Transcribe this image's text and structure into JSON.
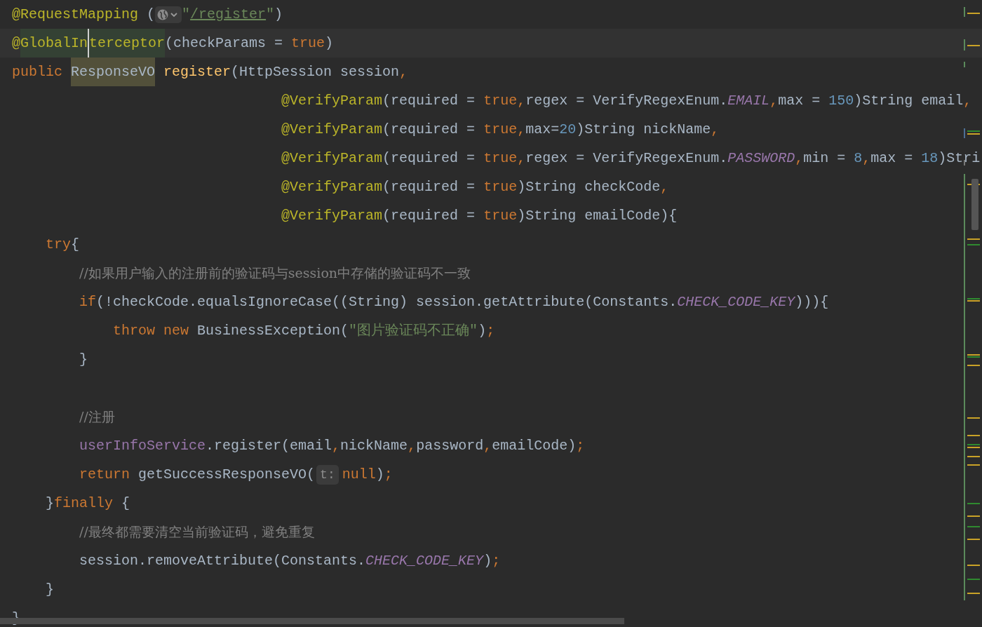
{
  "editor": {
    "lines": [
      {
        "kind": "code",
        "tokens": [
          {
            "text": "@RequestMapping",
            "kind": "annotation"
          },
          {
            "text": " (",
            "kind": "plain"
          },
          {
            "kind": "url-hint"
          },
          {
            "text": "\"",
            "kind": "string"
          },
          {
            "text": "/register",
            "kind": "link"
          },
          {
            "text": "\"",
            "kind": "string"
          },
          {
            "text": ")",
            "kind": "plain"
          }
        ]
      },
      {
        "kind": "code",
        "tokens": [
          {
            "text": "@",
            "kind": "annotation"
          },
          {
            "text": "GlobalIn",
            "kind": "annotation",
            "highlighted": true
          },
          {
            "text": "terceptor",
            "kind": "annotation",
            "highlighted": true,
            "caret_before": true
          },
          {
            "text": "(checkParams = ",
            "kind": "plain"
          },
          {
            "text": "true",
            "kind": "keyword"
          },
          {
            "text": ")",
            "kind": "plain"
          }
        ]
      },
      {
        "kind": "code",
        "tokens": [
          {
            "text": "public ",
            "kind": "keyword"
          },
          {
            "text": "ResponseVO",
            "kind": "plain",
            "highlighted": true
          },
          {
            "text": " register",
            "kind": "method"
          },
          {
            "text": "(HttpSession session",
            "kind": "plain"
          },
          {
            "text": ",",
            "kind": "keyword"
          }
        ]
      },
      {
        "kind": "code",
        "tokens": [
          {
            "text": "                                @VerifyParam",
            "kind": "annotation"
          },
          {
            "text": "(required = ",
            "kind": "plain"
          },
          {
            "text": "true,",
            "kind": "keyword"
          },
          {
            "text": "regex = VerifyRegexEnum.",
            "kind": "plain"
          },
          {
            "text": "EMAIL",
            "kind": "constant"
          },
          {
            "text": ",",
            "kind": "keyword"
          },
          {
            "text": "max = ",
            "kind": "plain"
          },
          {
            "text": "150",
            "kind": "number"
          },
          {
            "text": ")String email",
            "kind": "plain"
          },
          {
            "text": ",",
            "kind": "keyword"
          }
        ]
      },
      {
        "kind": "code",
        "tokens": [
          {
            "text": "                                @VerifyParam",
            "kind": "annotation"
          },
          {
            "text": "(required = ",
            "kind": "plain"
          },
          {
            "text": "true,",
            "kind": "keyword"
          },
          {
            "text": "max=",
            "kind": "plain"
          },
          {
            "text": "20",
            "kind": "number"
          },
          {
            "text": ")String nickName",
            "kind": "plain"
          },
          {
            "text": ",",
            "kind": "keyword"
          }
        ]
      },
      {
        "kind": "code",
        "tokens": [
          {
            "text": "                                @VerifyParam",
            "kind": "annotation"
          },
          {
            "text": "(required = ",
            "kind": "plain"
          },
          {
            "text": "true,",
            "kind": "keyword"
          },
          {
            "text": "regex = VerifyRegexEnum.",
            "kind": "plain"
          },
          {
            "text": "PASSWORD",
            "kind": "constant"
          },
          {
            "text": ",",
            "kind": "keyword"
          },
          {
            "text": "min = ",
            "kind": "plain"
          },
          {
            "text": "8",
            "kind": "number"
          },
          {
            "text": ",",
            "kind": "keyword"
          },
          {
            "text": "max = ",
            "kind": "plain"
          },
          {
            "text": "18",
            "kind": "number"
          },
          {
            "text": ")Stri",
            "kind": "plain"
          }
        ]
      },
      {
        "kind": "code",
        "tokens": [
          {
            "text": "                                @VerifyParam",
            "kind": "annotation"
          },
          {
            "text": "(required = ",
            "kind": "plain"
          },
          {
            "text": "true",
            "kind": "keyword"
          },
          {
            "text": ")String checkCode",
            "kind": "plain"
          },
          {
            "text": ",",
            "kind": "keyword"
          }
        ]
      },
      {
        "kind": "code",
        "tokens": [
          {
            "text": "                                @VerifyParam",
            "kind": "annotation"
          },
          {
            "text": "(required = ",
            "kind": "plain"
          },
          {
            "text": "true",
            "kind": "keyword"
          },
          {
            "text": ")String emailCode){",
            "kind": "plain"
          }
        ]
      },
      {
        "kind": "code",
        "tokens": [
          {
            "text": "    try",
            "kind": "keyword"
          },
          {
            "text": "{",
            "kind": "plain"
          }
        ]
      },
      {
        "kind": "code",
        "tokens": [
          {
            "text": "        //如果用户输入的注册前的验证码与session中存储的验证码不一致",
            "kind": "comment"
          }
        ]
      },
      {
        "kind": "code",
        "tokens": [
          {
            "text": "        if",
            "kind": "keyword"
          },
          {
            "text": "(!checkCode.equalsIgnoreCase((String) session.getAttribute(Constants.",
            "kind": "plain"
          },
          {
            "text": "CHECK_CODE_KEY",
            "kind": "constant"
          },
          {
            "text": "))){",
            "kind": "plain"
          }
        ]
      },
      {
        "kind": "code",
        "tokens": [
          {
            "text": "            throw new",
            "kind": "keyword"
          },
          {
            "text": " BusinessException(",
            "kind": "plain"
          },
          {
            "text": "\"图片验证码不正确\"",
            "kind": "string"
          },
          {
            "text": ")",
            "kind": "plain"
          },
          {
            "text": ";",
            "kind": "keyword"
          }
        ]
      },
      {
        "kind": "code",
        "tokens": [
          {
            "text": "        }",
            "kind": "plain"
          }
        ]
      },
      {
        "kind": "blank"
      },
      {
        "kind": "code",
        "tokens": [
          {
            "text": "        //注册",
            "kind": "comment"
          }
        ]
      },
      {
        "kind": "code",
        "tokens": [
          {
            "text": "        userInfoService",
            "kind": "field"
          },
          {
            "text": ".register(email",
            "kind": "plain"
          },
          {
            "text": ",",
            "kind": "keyword"
          },
          {
            "text": "nickName",
            "kind": "plain"
          },
          {
            "text": ",",
            "kind": "keyword"
          },
          {
            "text": "password",
            "kind": "plain"
          },
          {
            "text": ",",
            "kind": "keyword"
          },
          {
            "text": "emailCode)",
            "kind": "plain"
          },
          {
            "text": ";",
            "kind": "keyword"
          }
        ]
      },
      {
        "kind": "code",
        "tokens": [
          {
            "text": "        return",
            "kind": "keyword"
          },
          {
            "text": " getSuccessResponseVO(",
            "kind": "plain"
          },
          {
            "text": "t:",
            "kind": "param-hint"
          },
          {
            "text": "null",
            "kind": "keyword"
          },
          {
            "text": ")",
            "kind": "plain"
          },
          {
            "text": ";",
            "kind": "keyword"
          }
        ]
      },
      {
        "kind": "code",
        "tokens": [
          {
            "text": "    }",
            "kind": "plain"
          },
          {
            "text": "finally",
            "kind": "keyword"
          },
          {
            "text": " {",
            "kind": "plain"
          }
        ]
      },
      {
        "kind": "code",
        "tokens": [
          {
            "text": "        //最终都需要清空当前验证码，避免重复",
            "kind": "comment"
          }
        ]
      },
      {
        "kind": "code",
        "tokens": [
          {
            "text": "        session.removeAttribute(Constants.",
            "kind": "plain"
          },
          {
            "text": "CHECK_CODE_KEY",
            "kind": "constant"
          },
          {
            "text": ")",
            "kind": "plain"
          },
          {
            "text": ";",
            "kind": "keyword"
          }
        ]
      },
      {
        "kind": "code",
        "tokens": [
          {
            "text": "    }",
            "kind": "plain"
          }
        ]
      },
      {
        "kind": "code",
        "tokens": [
          {
            "text": "}",
            "kind": "plain"
          }
        ]
      }
    ]
  }
}
